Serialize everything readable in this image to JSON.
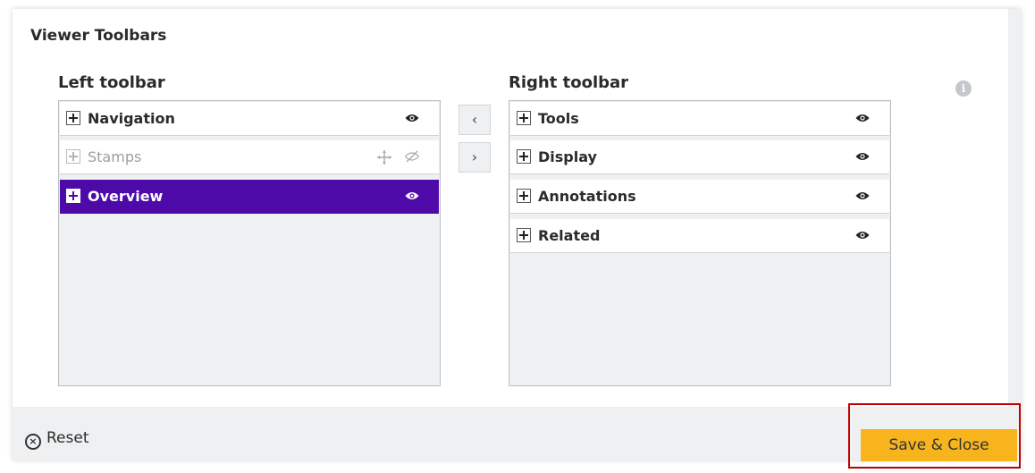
{
  "dialog": {
    "title": "Viewer Toolbars"
  },
  "left": {
    "title": "Left toolbar",
    "items": [
      {
        "label": "Navigation",
        "visible": true
      },
      {
        "label": "Stamps",
        "visible": false
      },
      {
        "label": "Overview",
        "visible": true,
        "selected": true
      }
    ]
  },
  "right": {
    "title": "Right toolbar",
    "items": [
      {
        "label": "Tools",
        "visible": true
      },
      {
        "label": "Display",
        "visible": true
      },
      {
        "label": "Annotations",
        "visible": true
      },
      {
        "label": "Related",
        "visible": true
      }
    ]
  },
  "buttons": {
    "move_left": "‹",
    "move_right": "›",
    "reset": "Reset",
    "save": "Save & Close"
  },
  "icons": {
    "info": "i",
    "reset": "×"
  },
  "colors": {
    "selected": "#4e0aa9",
    "save_button": "#f7b41d",
    "highlight_frame": "#c00000"
  }
}
